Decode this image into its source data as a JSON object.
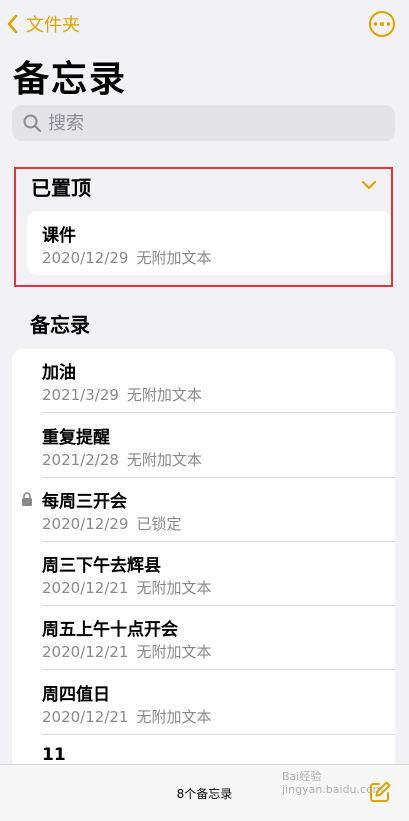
{
  "nav": {
    "back_label": "文件夹"
  },
  "page_title": "备忘录",
  "search": {
    "placeholder": "搜索"
  },
  "pinned": {
    "header": "已置顶",
    "notes": [
      {
        "title": "课件",
        "date": "2020/12/29",
        "preview": "无附加文本"
      }
    ]
  },
  "notes_section": {
    "header": "备忘录",
    "notes": [
      {
        "title": "加油",
        "date": "2021/3/29",
        "preview": "无附加文本",
        "locked": false
      },
      {
        "title": "重复提醒",
        "date": "2021/2/28",
        "preview": "无附加文本",
        "locked": false
      },
      {
        "title": "每周三开会",
        "date": "2020/12/29",
        "preview": "已锁定",
        "locked": true
      },
      {
        "title": "周三下午去辉县",
        "date": "2020/12/21",
        "preview": "无附加文本",
        "locked": false
      },
      {
        "title": "周五上午十点开会",
        "date": "2020/12/21",
        "preview": "无附加文本",
        "locked": false
      },
      {
        "title": "周四值日",
        "date": "2020/12/21",
        "preview": "无附加文本",
        "locked": false
      },
      {
        "title": "11",
        "date": "",
        "preview": "",
        "locked": false
      }
    ]
  },
  "footer": {
    "count_label": "8个备忘录"
  },
  "watermark": {
    "line1": "Bai经验",
    "line2": "jingyan.baidu.com"
  },
  "colors": {
    "accent": "#e1a300",
    "highlight_border": "#e0343a"
  }
}
